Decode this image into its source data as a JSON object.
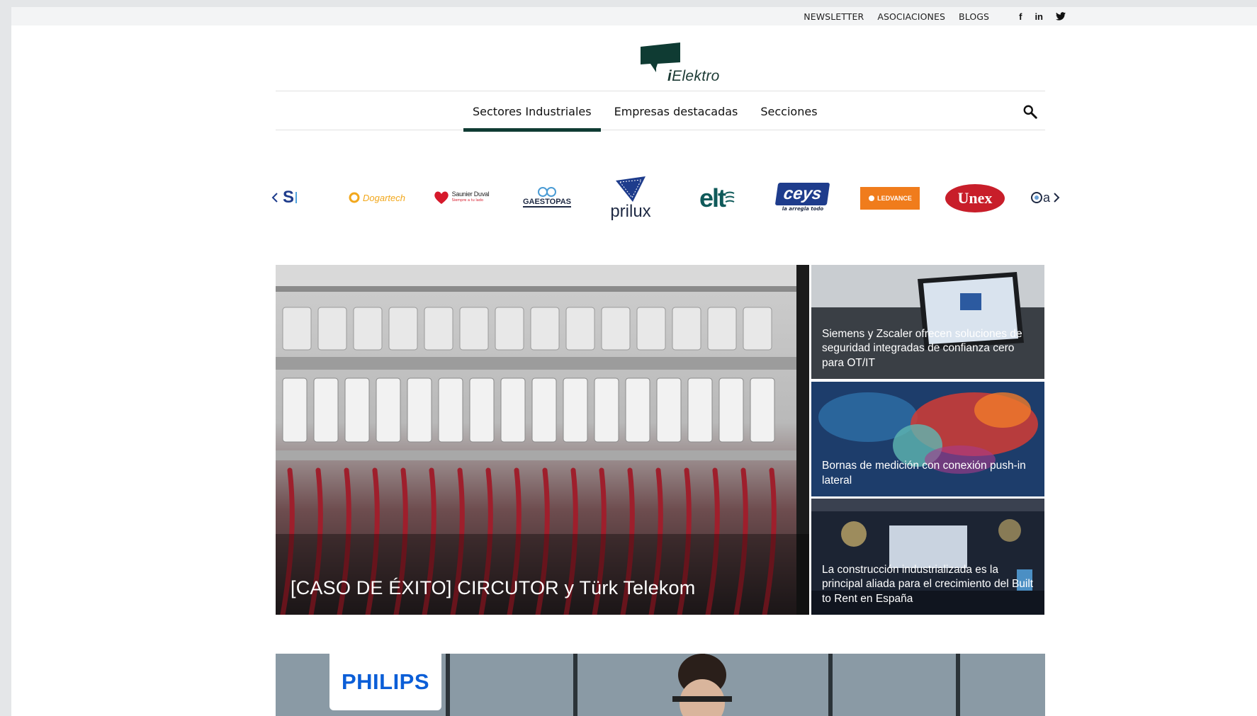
{
  "topbar": {
    "links": [
      "NEWSLETTER",
      "ASOCIACIONES",
      "BLOGS"
    ],
    "social": [
      {
        "icon": "facebook-icon",
        "glyph": "f"
      },
      {
        "icon": "linkedin-icon",
        "glyph": "in"
      },
      {
        "icon": "twitter-icon",
        "glyph": "🐦"
      }
    ]
  },
  "logo": {
    "text_bold": "i",
    "text": "Elektro"
  },
  "nav": {
    "items": [
      "Sectores Industriales",
      "Empresas destacadas",
      "Secciones"
    ],
    "active_index": 0,
    "search_icon": "search-icon"
  },
  "brands": [
    "S",
    "Dogartech",
    "Saunier Duval",
    "GAESTOPAS",
    "prilux",
    "elt",
    "ceys",
    "LEDVANCE",
    "Unex",
    "a"
  ],
  "brand_subtexts": {
    "ceys": "la arregla todo",
    "saunier": "Siempre a tu lado"
  },
  "featured": {
    "title": "[CASO DE ÉXITO] CIRCUTOR y Türk Telekom"
  },
  "side_articles": [
    {
      "title": "Siemens y Zscaler ofrecen soluciones de seguridad integradas de confianza cero para OT/IT"
    },
    {
      "title": "Bornas de medición con conexión push-in lateral"
    },
    {
      "title": "La construcción industrializada es la principal aliada para el crecimiento del Built to Rent en España"
    }
  ],
  "banner": {
    "brand": "PHILIPS"
  },
  "colors": {
    "accent": "#0f3b33",
    "background": "#ffffff",
    "topbar": "#f3f4f5"
  }
}
